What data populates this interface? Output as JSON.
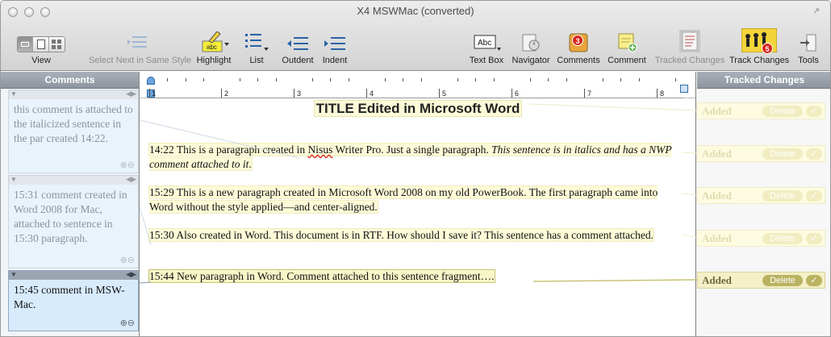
{
  "window": {
    "title": "X4 MSWMac (converted)"
  },
  "toolbar": {
    "view": "View",
    "select_next": "Select Next in Same Style",
    "highlight": "Highlight",
    "highlight_icon_text": "abc",
    "list": "List",
    "outdent": "Outdent",
    "indent": "Indent",
    "text_box": "Text Box",
    "text_box_icon_text": "Abc",
    "navigator": "Navigator",
    "comments": "Comments",
    "comments_badge": "3",
    "comment": "Comment",
    "tracked_changes": "Tracked Changes",
    "track_changes": "Track Changes",
    "track_changes_badge": "5",
    "tools": "Tools"
  },
  "comments_panel": {
    "header": "Comments",
    "items": [
      {
        "text": "this comment is attached to the italicized sentence in the par created 14:22."
      },
      {
        "text": "15:31 comment created in Word 2008 for Mac, attached to sentence in 15:30 paragraph."
      },
      {
        "text": "15:45 comment in MSW-Mac."
      }
    ]
  },
  "ruler": {
    "numbers": [
      "1",
      "2",
      "3",
      "4",
      "5",
      "6",
      "7",
      "8"
    ]
  },
  "document": {
    "title": "TITLE Edited in Microsoft Word",
    "p1_a": "14:22 This is a paragraph created in ",
    "p1_b": "Nisus",
    "p1_c": " Writer Pro. Just a single paragraph. ",
    "p1_d": "This sentence is in italics and has a NWP comment attached to it",
    "p1_e": ".",
    "p2": "15:29 This is a new paragraph created in Microsoft Word 2008 on my old PowerBook. The first paragraph came into Word without the style applied—and center-aligned.",
    "p3": "15:30 Also created in Word. This document is in RTF. How should I save it? This sentence has a comment attached.",
    "p4": "15:44 New paragraph in Word. Comment attached to this sentence fragment…."
  },
  "tracked_changes_panel": {
    "header": "Tracked Changes",
    "rows": [
      {
        "label": "Added",
        "delete": "Delete",
        "accept": "✓"
      },
      {
        "label": "Added",
        "delete": "Delete",
        "accept": "✓"
      },
      {
        "label": "Added",
        "delete": "Delete",
        "accept": "✓"
      },
      {
        "label": "Added",
        "delete": "Delete",
        "accept": "✓"
      },
      {
        "label": "Added",
        "delete": "Delete",
        "accept": "✓"
      }
    ]
  },
  "colors": {
    "highlight": "#fdfbd8",
    "active_comment": "#d8ebfc",
    "panel_header": "#9aa1aa",
    "badge": "#d9261c"
  }
}
